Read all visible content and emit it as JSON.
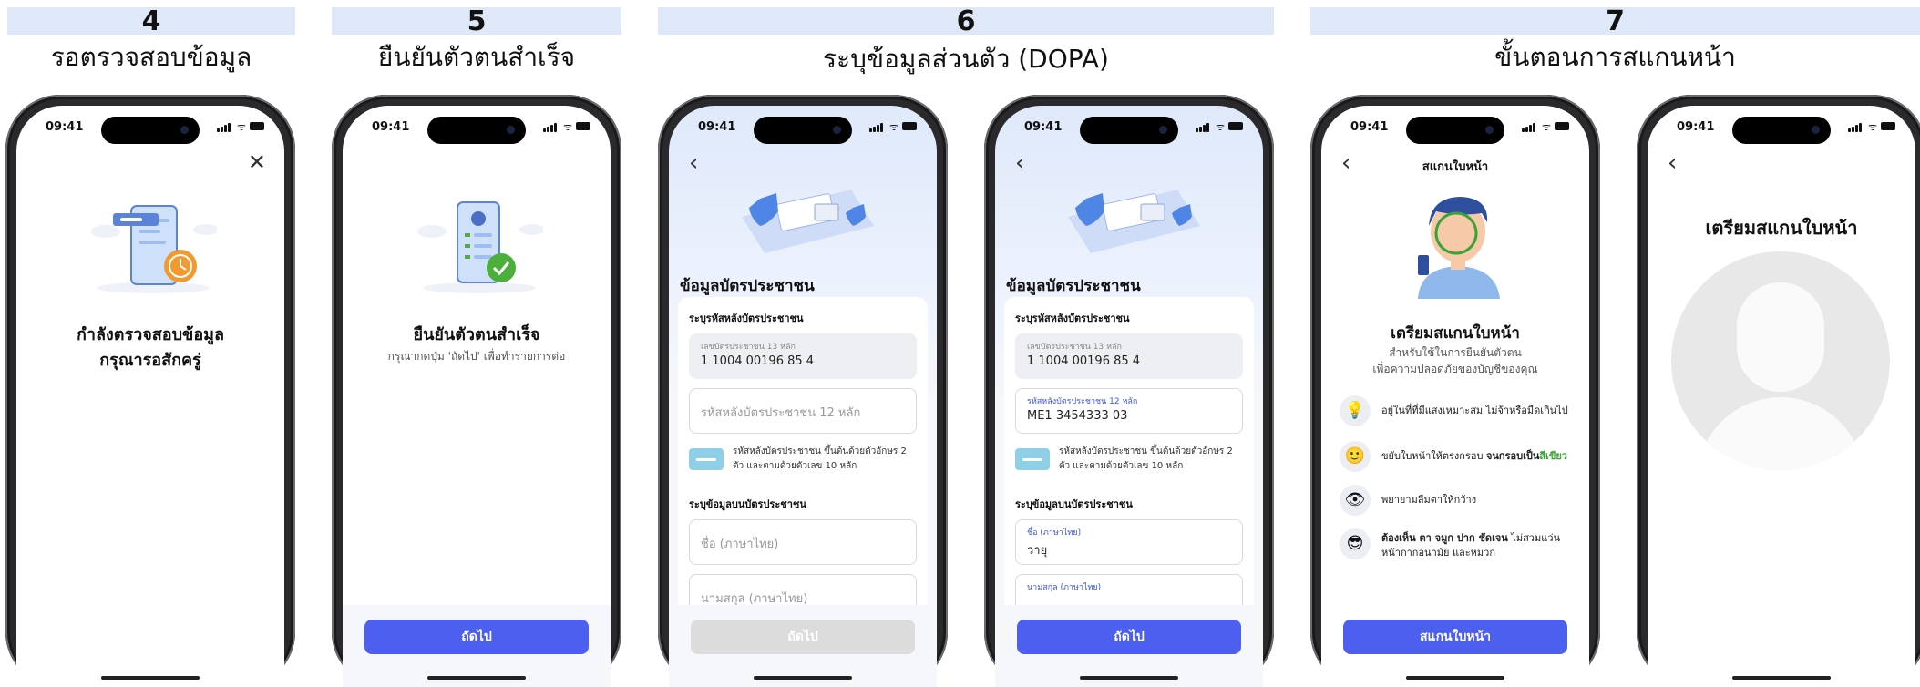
{
  "steps": [
    {
      "number": "4",
      "title": "รอตรวจสอบข้อมูล"
    },
    {
      "number": "5",
      "title": "ยืนยันตัวตนสำเร็จ"
    },
    {
      "number": "6",
      "title": "ระบุข้อมูลส่วนตัว (DOPA)"
    },
    {
      "number": "7",
      "title": "ขั้นตอนการสแกนหน้า"
    }
  ],
  "status_time": "09:41",
  "s4": {
    "line1": "กำลังตรวจสอบข้อมูล",
    "line2": "กรุณารอสักครู่"
  },
  "s5": {
    "title": "ยืนยันตัวตนสำเร็จ",
    "subtitle": "กรุณากดปุ่ม 'ถัดไป' เพื่อทำรายการต่อ",
    "button": "ถัดไป"
  },
  "dopa": {
    "section_title": "ข้อมูลบัตรประชาชน",
    "back_label": "ระบุรหัสหลังบัตรประชาชน",
    "id_label": "เลขบัตรประชาชน 13 หลัก",
    "id_value": "1 1004 00196 85 4",
    "laser_placeholder": "รหัสหลังบัตรประชาชน 12 หลัก",
    "laser_label": "รหัสหลังบัตรประชาชน 12 หลัก",
    "laser_value": "ME1 3454333 03",
    "hint_line1": "รหัสหลังบัตรประชาชน ขึ้นต้นด้วยตัวอักษร 2",
    "hint_line2": "ตัว และตามด้วยตัวเลข 10 หลัก",
    "card_info_label": "ระบุข้อมูลบนบัตรประชาชน",
    "name_label": "ชื่อ (ภาษาไทย)",
    "name_value": "วายุ",
    "surname_label": "นามสกุล (ภาษาไทย)",
    "button": "ถัดไป"
  },
  "scan": {
    "header": "สแกนใบหน้า",
    "title": "เตรียมสแกนใบหน้า",
    "desc1": "สำหรับใช้ในการยืนยันตัวตน",
    "desc2": "เพื่อความปลอดภัยของบัญชีของคุณ",
    "tip1": "อยู่ในที่ที่มีแสงเหมาะสม ไม่จ้าหรือมืดเกินไป",
    "tip2_a": "ขยับใบหน้าให้ตรงกรอบ ",
    "tip2_b": "จนกรอบเป็น",
    "tip2_c": "สีเขียว",
    "tip3": "พยายามลืมตาให้กว้าง",
    "tip4_a": "ต้องเห็น ตา จมูก ปาก ชัดเจน",
    "tip4_b": " ไม่สวมแว่น",
    "tip4_c": "หน้ากากอนามัย และหมวก",
    "button": "สแกนใบหน้า",
    "prep_title": "เตรียมสแกนใบหน้า"
  },
  "colors": {
    "accent": "#4d5fef",
    "step_bar": "#dfe8f8",
    "success": "#4caf3c",
    "timer": "#f29a2e"
  }
}
